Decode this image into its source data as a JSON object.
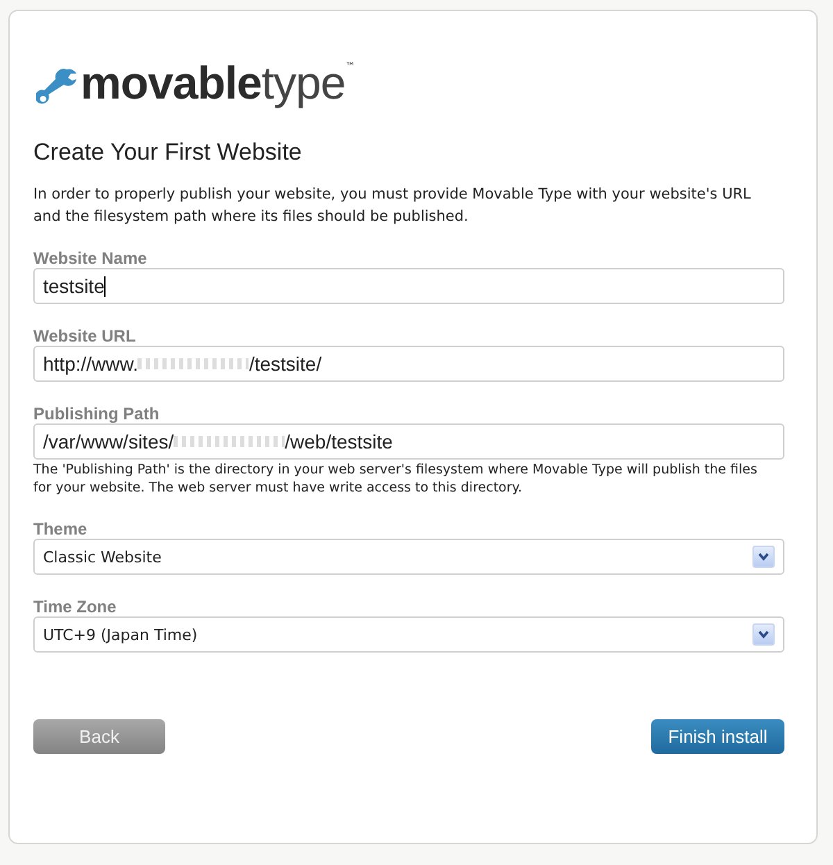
{
  "logo": {
    "text_bold": "movable",
    "text_light": "type",
    "trademark": "™"
  },
  "heading": "Create Your First Website",
  "intro": "In order to properly publish your website, you must provide Movable Type with your website's URL and the filesystem path where its files should be published.",
  "fields": [
    {
      "kind": "text",
      "label": "Website Name",
      "value": "testsite",
      "focused": true
    },
    {
      "kind": "redacted-text",
      "label": "Website URL",
      "value_start": "http://www.",
      "value_end": "/testsite/"
    },
    {
      "kind": "redacted-text",
      "label": "Publishing Path",
      "value_start": "/var/www/sites/",
      "value_end": "/web/testsite",
      "hint": "The 'Publishing Path' is the directory in your web server's filesystem where Movable Type will publish the files for your website. The web server must have write access to this directory."
    },
    {
      "kind": "select",
      "label": "Theme",
      "value": "Classic Website"
    },
    {
      "kind": "select",
      "label": "Time Zone",
      "value": "UTC+9 (Japan Time)"
    }
  ],
  "buttons": [
    {
      "label": "Back",
      "kind": "secondary"
    },
    {
      "label": "Finish install",
      "kind": "primary"
    }
  ]
}
